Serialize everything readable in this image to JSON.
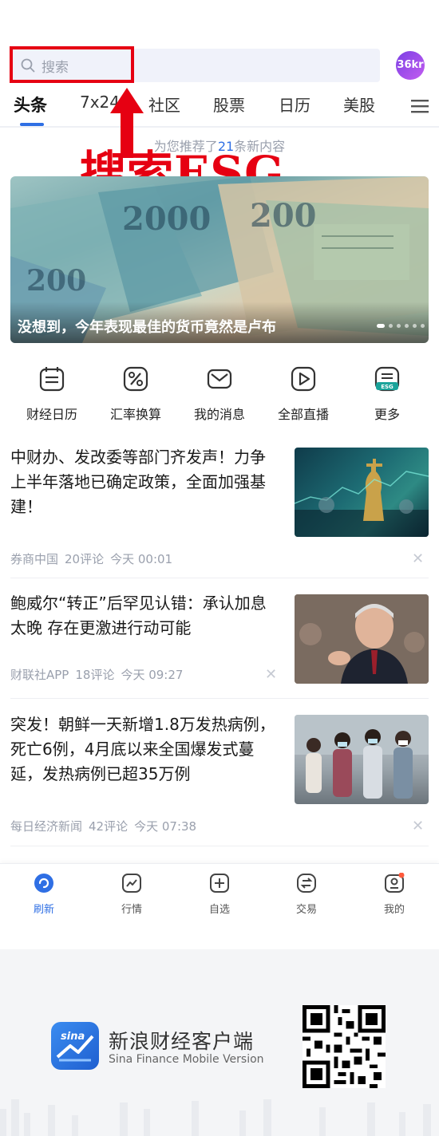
{
  "search": {
    "placeholder": "搜索"
  },
  "avatar": {
    "label": "36kr"
  },
  "tabs": [
    {
      "label": "头条"
    },
    {
      "label": "7x24"
    },
    {
      "label": "社区"
    },
    {
      "label": "股票"
    },
    {
      "label": "日历"
    },
    {
      "label": "美股"
    }
  ],
  "recommend": {
    "prefix": "为您推荐了",
    "count": "21",
    "suffix": "条新内容"
  },
  "annotation": {
    "text": "搜索ESG"
  },
  "banner": {
    "title": "没想到，今年表现最佳的货币竟然是卢布"
  },
  "quick_actions": [
    {
      "label": "财经日历",
      "icon": "calendar-icon"
    },
    {
      "label": "汇率换算",
      "icon": "percent-icon"
    },
    {
      "label": "我的消息",
      "icon": "message-icon"
    },
    {
      "label": "全部直播",
      "icon": "live-play-icon"
    },
    {
      "label": "更多",
      "icon": "esg-icon"
    }
  ],
  "news": [
    {
      "title": "中财办、发改委等部门齐发声！力争上半年落地已确定政策，全面加强基建！",
      "source": "券商中国",
      "comments": "20评论",
      "time": "今天 00:01"
    },
    {
      "title": "鲍威尔“转正”后罕见认错：承认加息太晚 存在更激进行动可能",
      "source": "财联社APP",
      "comments": "18评论",
      "time": "今天 09:27"
    },
    {
      "title": "突发！朝鲜一天新增1.8万发热病例，死亡6例，4月底以来全国爆发式蔓延，发热病例已超35万例",
      "source": "每日经济新闻",
      "comments": "42评论",
      "time": "今天 07:38"
    }
  ],
  "bottom_nav": [
    {
      "label": "刷新"
    },
    {
      "label": "行情"
    },
    {
      "label": "自选"
    },
    {
      "label": "交易"
    },
    {
      "label": "我的"
    }
  ],
  "footer": {
    "app_name": "新浪财经客户端",
    "app_sub": "Sina Finance Mobile Version"
  },
  "colors": {
    "accent": "#2f6fe4",
    "annotation": "#e60012"
  }
}
